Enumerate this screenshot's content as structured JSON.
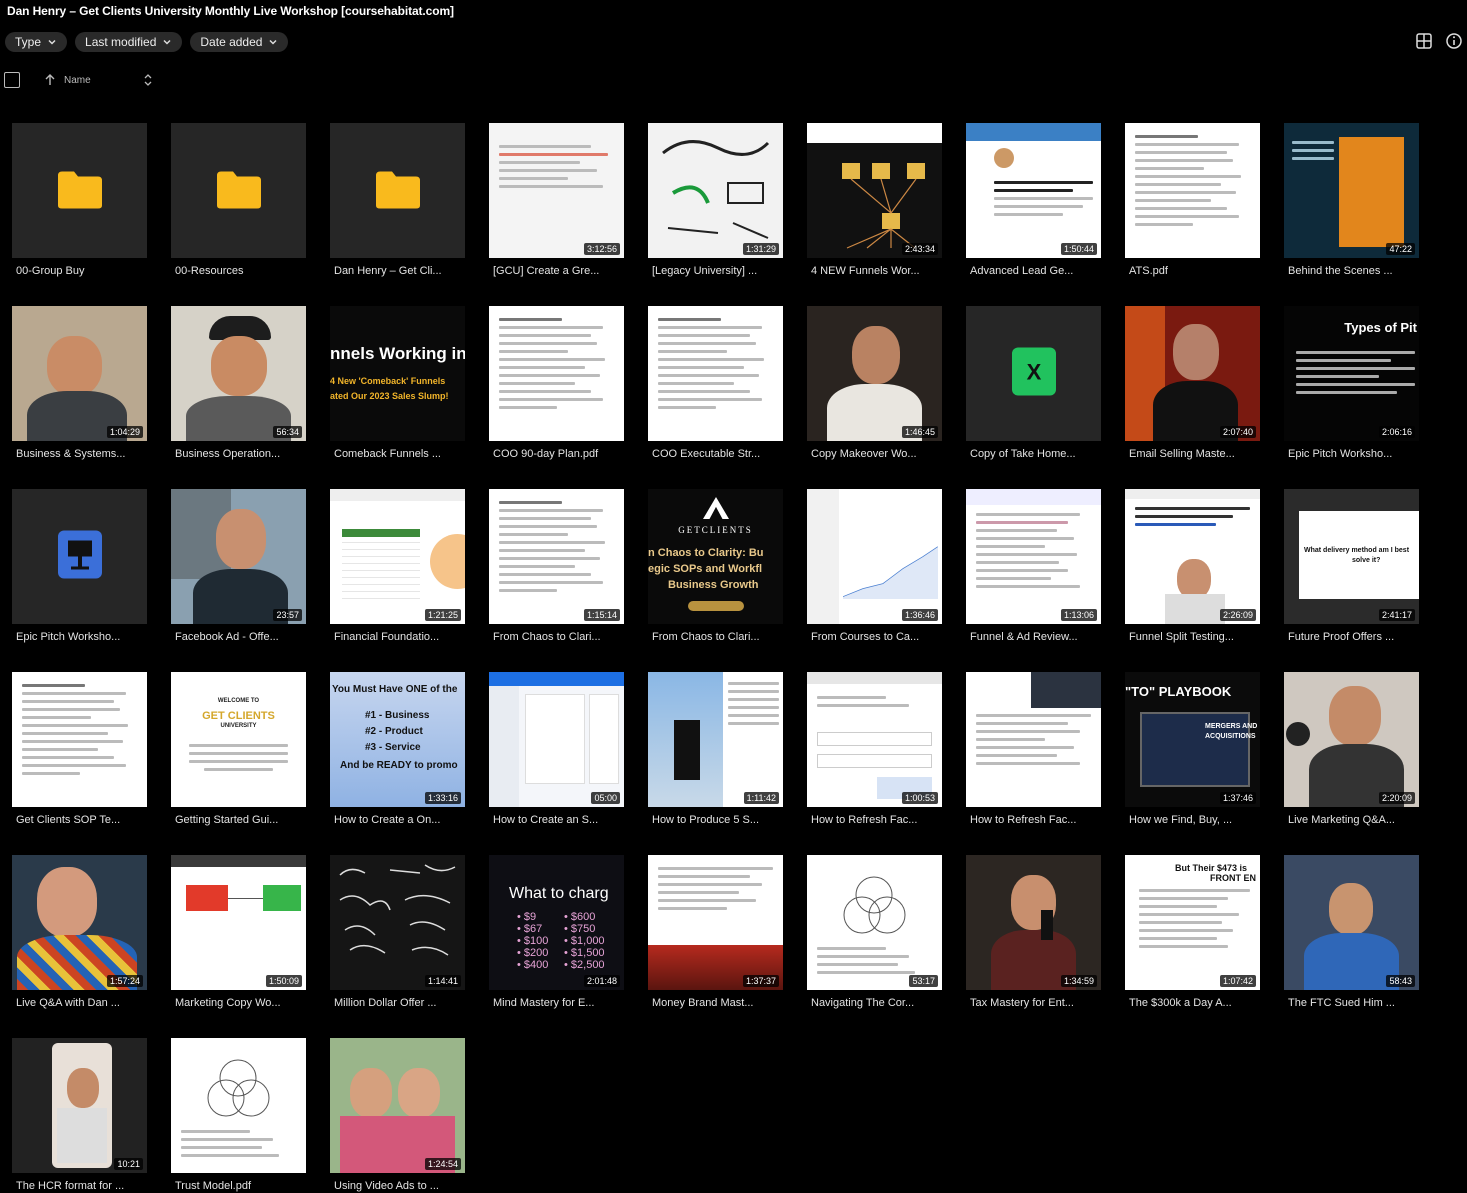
{
  "window": {
    "title": "Dan Henry – Get Clients University Monthly Live Workshop [coursehabitat.com]"
  },
  "filters": {
    "type_label": "Type",
    "last_modified_label": "Last modified",
    "date_added_label": "Date added"
  },
  "sort": {
    "column_label": "Name"
  },
  "colors": {
    "background": "#000000",
    "tile_bg": "#262626",
    "folder": "#f9ba1d",
    "excel": "#21c25e",
    "keynote": "#3b6fd9"
  },
  "items": [
    {
      "name": "00-Group Buy",
      "kind": "folder",
      "icon": "folder-icon"
    },
    {
      "name": "00-Resources",
      "kind": "folder",
      "icon": "folder-icon"
    },
    {
      "name": "Dan Henry – Get Cli...",
      "kind": "folder",
      "icon": "folder-icon"
    },
    {
      "name": "[GCU] Create a Gre...",
      "kind": "video",
      "duration": "3:12:56",
      "scene": "whiteboard-doc"
    },
    {
      "name": "[Legacy University] ...",
      "kind": "video",
      "duration": "1:31:29",
      "scene": "whiteboard-sketch"
    },
    {
      "name": "4 NEW Funnels Wor...",
      "kind": "video",
      "duration": "2:43:34",
      "scene": "funnel-diagram"
    },
    {
      "name": "Advanced Lead Ge...",
      "kind": "video",
      "duration": "1:50:44",
      "scene": "social-post"
    },
    {
      "name": "ATS.pdf",
      "kind": "pdf",
      "scene": "pdf-doc"
    },
    {
      "name": "Behind the Scenes ...",
      "kind": "video",
      "duration": "47:22",
      "scene": "slides-dark"
    },
    {
      "name": "Business & Systems...",
      "kind": "video",
      "duration": "1:04:29",
      "scene": "person-room"
    },
    {
      "name": "Business Operation...",
      "kind": "video",
      "duration": "56:34",
      "scene": "person-cap"
    },
    {
      "name": "Comeback Funnels ...",
      "kind": "video",
      "scene": "title-slide"
    },
    {
      "name": "COO 90-day Plan.pdf",
      "kind": "pdf",
      "scene": "pdf-doc"
    },
    {
      "name": "COO Executable Str...",
      "kind": "video",
      "scene": "pdf-doc"
    },
    {
      "name": "Copy Makeover Wo...",
      "kind": "video",
      "duration": "1:46:45",
      "scene": "person-dark"
    },
    {
      "name": "Copy of Take Home...",
      "kind": "sheet",
      "icon": "excel-icon"
    },
    {
      "name": "Email Selling Maste...",
      "kind": "video",
      "duration": "2:07:40",
      "scene": "person-red"
    },
    {
      "name": "Epic Pitch Worksho...",
      "kind": "video",
      "duration": "2:06:16",
      "scene": "slides-dark-text"
    },
    {
      "name": "Epic Pitch Worksho...",
      "kind": "keynote",
      "icon": "keynote-icon"
    },
    {
      "name": "Facebook Ad - Offe...",
      "kind": "video",
      "duration": "23:57",
      "scene": "person-bridge"
    },
    {
      "name": "Financial Foundatio...",
      "kind": "video",
      "duration": "1:21:25",
      "scene": "spreadsheet"
    },
    {
      "name": "From Chaos to Clari...",
      "kind": "video",
      "duration": "1:15:14",
      "scene": "pdf-doc"
    },
    {
      "name": "From Chaos to Clari...",
      "kind": "video",
      "scene": "gcu-title"
    },
    {
      "name": "From Courses to Ca...",
      "kind": "video",
      "duration": "1:36:46",
      "scene": "dashboard"
    },
    {
      "name": "Funnel & Ad Review...",
      "kind": "video",
      "duration": "1:13:06",
      "scene": "doc-list"
    },
    {
      "name": "Funnel Split Testing...",
      "kind": "video",
      "duration": "2:26:09",
      "scene": "webpage-person"
    },
    {
      "name": "Future Proof Offers ...",
      "kind": "video",
      "duration": "2:41:17",
      "scene": "question-slide"
    },
    {
      "name": "Get Clients SOP Te...",
      "kind": "doc",
      "scene": "pdf-doc"
    },
    {
      "name": "Getting Started Gui...",
      "kind": "doc",
      "scene": "welcome-doc"
    },
    {
      "name": "How to Create a On...",
      "kind": "video",
      "duration": "1:33:16",
      "scene": "list-slide"
    },
    {
      "name": "How to Create an S...",
      "kind": "video",
      "duration": "05:00",
      "scene": "app-screen"
    },
    {
      "name": "How to Produce 5 S...",
      "kind": "video",
      "duration": "1:11:42",
      "scene": "social-feed"
    },
    {
      "name": "How to Refresh Fac...",
      "kind": "video",
      "duration": "1:00:53",
      "scene": "web-form"
    },
    {
      "name": "How to Refresh Fac...",
      "kind": "video",
      "scene": "doc-video"
    },
    {
      "name": "How we Find, Buy, ...",
      "kind": "video",
      "duration": "1:37:46",
      "scene": "playbook"
    },
    {
      "name": "Live Marketing Q&A...",
      "kind": "video",
      "duration": "2:20:09",
      "scene": "person-mic"
    },
    {
      "name": "Live Q&A with Dan ...",
      "kind": "video",
      "duration": "1:57:24",
      "scene": "person-shirt"
    },
    {
      "name": "Marketing Copy Wo...",
      "kind": "video",
      "duration": "1:50:09",
      "scene": "boxes-diagram"
    },
    {
      "name": "Million Dollar Offer ...",
      "kind": "video",
      "duration": "1:14:41",
      "scene": "chalkboard"
    },
    {
      "name": "Mind Mastery for E...",
      "kind": "video",
      "duration": "2:01:48",
      "scene": "pricing-slide"
    },
    {
      "name": "Money Brand Mast...",
      "kind": "video",
      "duration": "1:37:37",
      "scene": "doc-red"
    },
    {
      "name": "Navigating The Cor...",
      "kind": "video",
      "duration": "53:17",
      "scene": "venn-doc"
    },
    {
      "name": "Tax Mastery for Ent...",
      "kind": "video",
      "duration": "1:34:59",
      "scene": "person-mic2"
    },
    {
      "name": "The $300k a Day A...",
      "kind": "video",
      "duration": "1:07:42",
      "scene": "cruise-list"
    },
    {
      "name": "The FTC Sued Him ...",
      "kind": "video",
      "duration": "58:43",
      "scene": "person-blue"
    },
    {
      "name": "The HCR format for ...",
      "kind": "video",
      "duration": "10:21",
      "scene": "person-phone"
    },
    {
      "name": "Trust Model.pdf",
      "kind": "pdf",
      "scene": "venn-doc"
    },
    {
      "name": "Using Video Ads to ...",
      "kind": "video",
      "duration": "1:24:54",
      "scene": "photo-people"
    }
  ]
}
